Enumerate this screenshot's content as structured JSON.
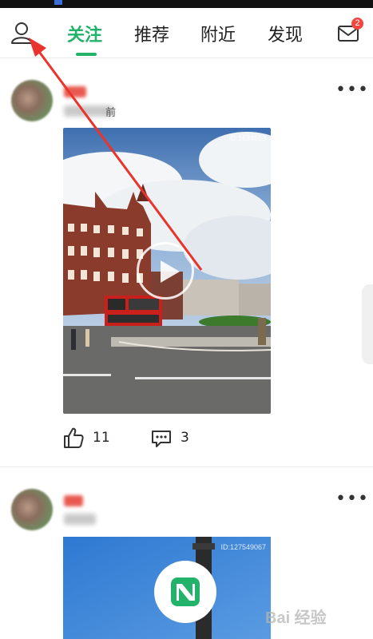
{
  "nav": {
    "tabs": [
      {
        "label": "关注",
        "active": true
      },
      {
        "label": "推荐",
        "active": false
      },
      {
        "label": "附近",
        "active": false
      },
      {
        "label": "发现",
        "active": false
      }
    ],
    "user_icon": "user-icon",
    "mail_icon": "mail-icon",
    "mail_badge": "2"
  },
  "posts": [
    {
      "meta_tail": "前",
      "video_watermark": "ID:1624653",
      "likes": "11",
      "comments": "3"
    },
    {
      "video_watermark": "ID:127549067"
    }
  ],
  "watermark": "Bai 经验",
  "colors": {
    "accent": "#23b26a",
    "badge": "#f2453d",
    "annotation_arrow": "#e8342c"
  }
}
